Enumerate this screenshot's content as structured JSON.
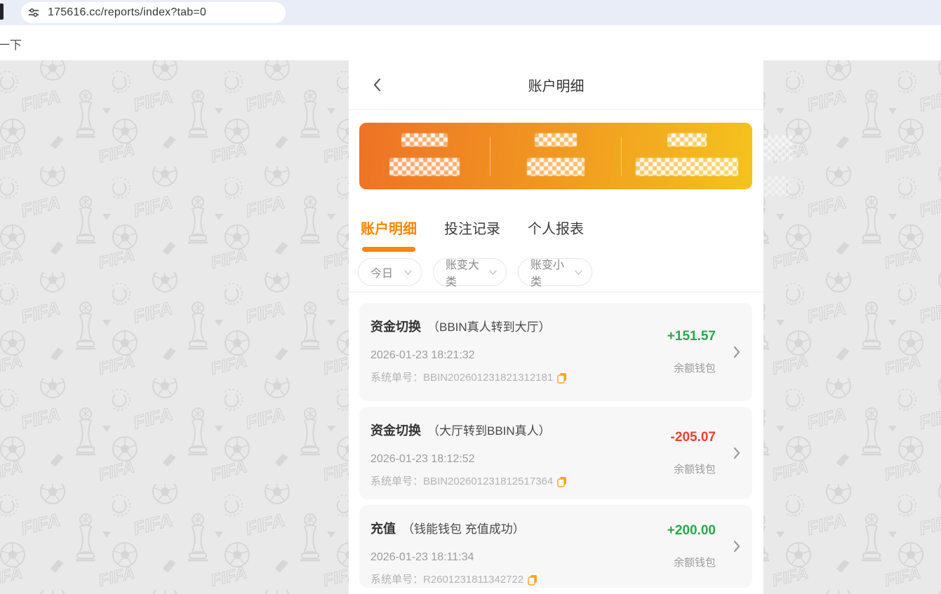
{
  "browser": {
    "url": "175616.cc/reports/index?tab=0"
  },
  "page": {
    "corner_text": "一下"
  },
  "header": {
    "title": "账户明细"
  },
  "summary_card": {
    "censored": true,
    "columns": 3
  },
  "tabs": [
    {
      "label": "账户明细",
      "active": true
    },
    {
      "label": "投注记录",
      "active": false
    },
    {
      "label": "个人报表",
      "active": false
    }
  ],
  "filters": [
    {
      "label": "今日"
    },
    {
      "label": "账变大类"
    },
    {
      "label": "账变小类"
    }
  ],
  "labels": {
    "serial": "系统单号："
  },
  "transactions": [
    {
      "type": "资金切换",
      "detail": "（BBIN真人转到大厅）",
      "datetime": "2026-01-23 18:21:32",
      "serial": "BBIN202601231821312181",
      "amount": "+151.57",
      "wallet": "余额钱包"
    },
    {
      "type": "资金切换",
      "detail": "（大厅转到BBIN真人）",
      "datetime": "2026-01-23 18:12:52",
      "serial": "BBIN202601231812517364",
      "amount": "-205.07",
      "wallet": "余额钱包"
    },
    {
      "type": "充值",
      "detail": "（钱能钱包 充值成功）",
      "datetime": "2026-01-23 18:11:34",
      "serial": "R2601231811342722",
      "amount": "+200.00",
      "wallet": "余额钱包"
    }
  ],
  "colors": {
    "accent": "#fb8600",
    "positive": "#2aa84c",
    "negative": "#ee4134",
    "card_gradient_start": "#ee7226",
    "card_gradient_end": "#f4c31d",
    "page_background": "#e9e9e9"
  }
}
